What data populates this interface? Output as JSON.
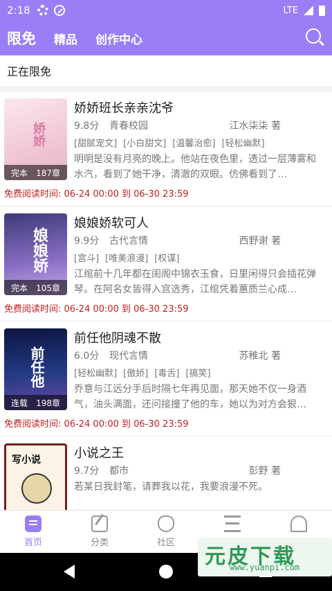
{
  "status_bar": {
    "time": "2:18",
    "network": "LTE"
  },
  "top_nav": {
    "tabs": [
      "限免",
      "精品",
      "创作中心"
    ]
  },
  "section": {
    "title": "正在限免"
  },
  "books": [
    {
      "title": "娇娇班长亲亲沈爷",
      "score": "9.8分",
      "genre": "青春校园",
      "author": "江水柒柒 著",
      "tags": [
        "[甜腻宠文]",
        "[小白甜文]",
        "[温馨治愈]",
        "[轻松幽默]"
      ],
      "desc": "明明是没有月亮的晚上。他站在夜色里，透过一层薄雾和水汽，看到了她干净，清澈的双眼。仿佛看到了…",
      "status": "完本",
      "chapters": "187章",
      "free_time": "免费阅读时间: 06-24 00:00 到 06-30 23:59",
      "cover_text": "娇娇班长",
      "cover_color": "#f3d6df"
    },
    {
      "title": "娘娘娇软可人",
      "score": "9.9分",
      "genre": "古代言情",
      "author": "西野谢 著",
      "tags": [
        "[宫斗]",
        "[唯美浪漫]",
        "[权谋]"
      ],
      "desc": "江绾前十几年都在闺阁中锦衣玉食，日里闲得只会插花弹琴。在阿名女皆得入宫选秀，江绾凭着蕙质兰心成…",
      "status": "完本",
      "chapters": "105章",
      "free_time": "免费阅读时间: 06-24 00:00 到 06-30 23:59",
      "cover_text": "娘娘娇",
      "cover_color": "#6a5aa8"
    },
    {
      "title": "前任他阴魂不散",
      "score": "6.0分",
      "genre": "现代言情",
      "author": "苏稚北 著",
      "tags": [
        "[轻松幽默]",
        "[傲娇]",
        "[毒舌]",
        "[搞笑]"
      ],
      "desc": "乔意与江远分手后时隔七年再见面，那天她不仅一身酒气，油头满面，还问接撞了他的车，她以为对方会狠…",
      "status": "连载",
      "chapters": "198章",
      "free_time": "免费阅读时间: 06-24 00:00 到 06-30 23:59",
      "cover_text": "前任他",
      "cover_color": "#1e2a5e"
    },
    {
      "title": "小说之王",
      "score": "9.7分",
      "genre": "都市",
      "author": "彭野 著",
      "tags": [],
      "desc": "若某日我封笔，请葬我以花，我要浪漫不死。",
      "status": "",
      "chapters": "",
      "free_time": "",
      "cover_text": "写小说",
      "cover_color": "#fbf3e6"
    }
  ],
  "bottom_nav": {
    "items": [
      "首页",
      "分类",
      "社区",
      "书架",
      "我的"
    ]
  },
  "watermark": {
    "logo": "元皮下载",
    "url": "www.yuanpi.com"
  },
  "colors": {
    "accent": "#9a7ef5",
    "free_time_red": "#c02020"
  }
}
